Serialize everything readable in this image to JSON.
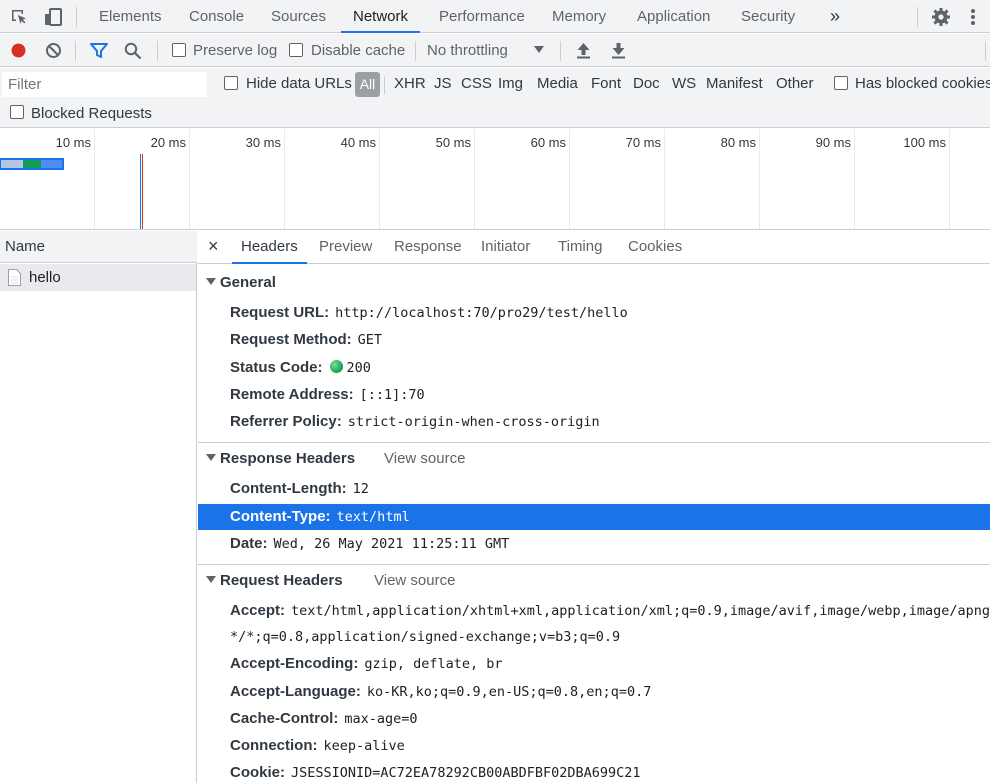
{
  "tabs": [
    "Elements",
    "Console",
    "Sources",
    "Network",
    "Performance",
    "Memory",
    "Application",
    "Security"
  ],
  "tabs_more": "»",
  "toolbar": {
    "preserve_log": "Preserve log",
    "disable_cache": "Disable cache",
    "throttling": "No throttling"
  },
  "filter": {
    "placeholder": "Filter",
    "hide_data_urls": "Hide data URLs",
    "all": "All",
    "types": [
      "XHR",
      "JS",
      "CSS",
      "Img",
      "Media",
      "Font",
      "Doc",
      "WS",
      "Manifest",
      "Other"
    ],
    "has_blocked_cookies": "Has blocked cookies",
    "blocked_requests": "Blocked Requests"
  },
  "overview": {
    "ticks": [
      "10 ms",
      "20 ms",
      "30 ms",
      "40 ms",
      "50 ms",
      "60 ms",
      "70 ms",
      "80 ms",
      "90 ms",
      "100 ms"
    ]
  },
  "list": {
    "header": "Name",
    "items": [
      "hello"
    ]
  },
  "details": {
    "close": "×",
    "tabs": [
      "Headers",
      "Preview",
      "Response",
      "Initiator",
      "Timing",
      "Cookies"
    ],
    "view_source": "View source",
    "general": {
      "title": "General",
      "rows": [
        {
          "k": "Request URL:",
          "v": "http://localhost:70/pro29/test/hello"
        },
        {
          "k": "Request Method:",
          "v": "GET"
        },
        {
          "k": "Status Code:",
          "v": "200"
        },
        {
          "k": "Remote Address:",
          "v": "[::1]:70"
        },
        {
          "k": "Referrer Policy:",
          "v": "strict-origin-when-cross-origin"
        }
      ]
    },
    "response": {
      "title": "Response Headers",
      "rows": [
        {
          "k": "Content-Length:",
          "v": "12"
        },
        {
          "k": "Content-Type:",
          "v": "text/html"
        },
        {
          "k": "Date:",
          "v": "Wed, 26 May 2021 11:25:11 GMT"
        }
      ]
    },
    "request": {
      "title": "Request Headers",
      "rows": [
        {
          "k": "Accept:",
          "v": "text/html,application/xhtml+xml,application/xml;q=0.9,image/avif,image/webp,image/apng,"
        },
        {
          "k": "",
          "v": "*/*;q=0.8,application/signed-exchange;v=b3;q=0.9"
        },
        {
          "k": "Accept-Encoding:",
          "v": "gzip, deflate, br"
        },
        {
          "k": "Accept-Language:",
          "v": "ko-KR,ko;q=0.9,en-US;q=0.8,en;q=0.7"
        },
        {
          "k": "Cache-Control:",
          "v": "max-age=0"
        },
        {
          "k": "Connection:",
          "v": "keep-alive"
        },
        {
          "k": "Cookie:",
          "v": "JSESSIONID=AC72EA78292CB00ABDFBF02DBA699C21"
        }
      ]
    }
  },
  "colors": {
    "accent": "#1a73e8",
    "record": "#d93025",
    "status_ok": "#0f9d58"
  }
}
